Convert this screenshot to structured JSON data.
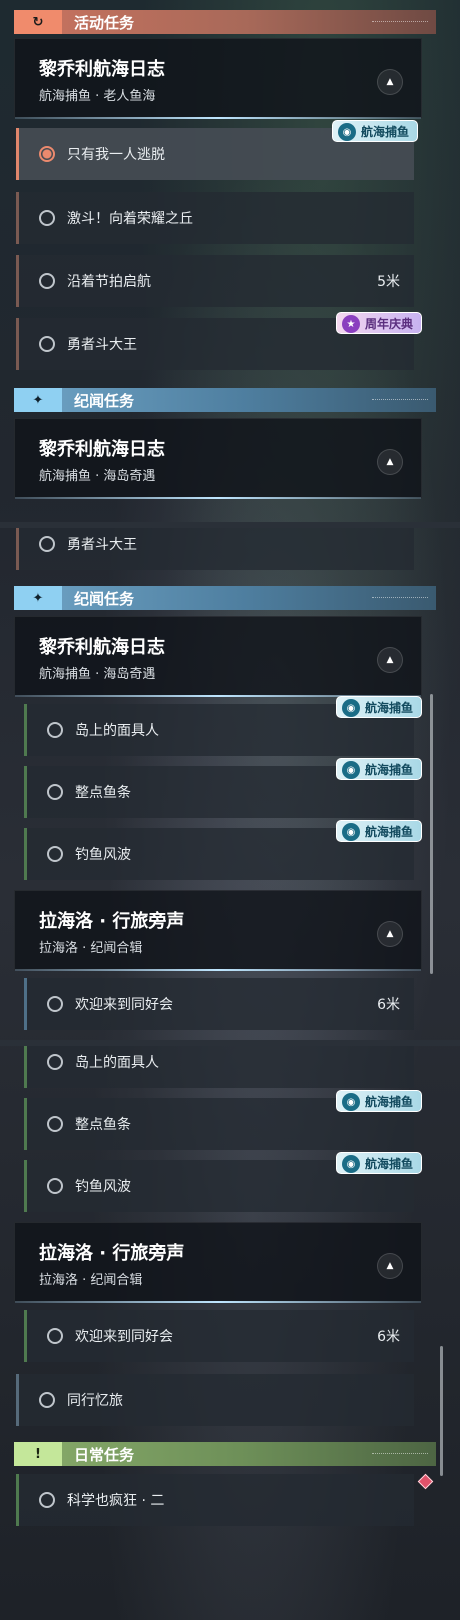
{
  "categories": {
    "activity": {
      "label": "活动任务",
      "icon": "↻"
    },
    "story": {
      "label": "纪闻任务",
      "icon": "✦"
    },
    "daily": {
      "label": "日常任务",
      "icon": "!"
    }
  },
  "groups": {
    "liqiaoli_old": {
      "title": "黎乔利航海日志",
      "subtitle": "航海捕鱼 · 老人鱼海"
    },
    "liqiaoli_island": {
      "title": "黎乔利航海日志",
      "subtitle": "航海捕鱼 · 海岛奇遇"
    },
    "lahailuo": {
      "title": "拉海洛 · 行旅旁声",
      "subtitle": "拉海洛 · 纪闻合辑"
    }
  },
  "quests": {
    "escape": {
      "name": "只有我一人逃脱"
    },
    "fight": {
      "name": "激斗！向着荣耀之丘"
    },
    "rhythm": {
      "name": "沿着节拍启航",
      "distance": "5米"
    },
    "bravest": {
      "name": "勇者斗大王"
    },
    "mask": {
      "name": "岛上的面具人"
    },
    "fishstrip": {
      "name": "整点鱼条"
    },
    "fishwave": {
      "name": "钓鱼风波"
    },
    "welcome": {
      "name": "欢迎来到同好会",
      "distance": "6米"
    },
    "companion": {
      "name": "同行忆旅"
    },
    "science": {
      "name": "科学也疯狂 · 二"
    }
  },
  "tags": {
    "fishing": "航海捕鱼",
    "anniversary": "周年庆典"
  }
}
